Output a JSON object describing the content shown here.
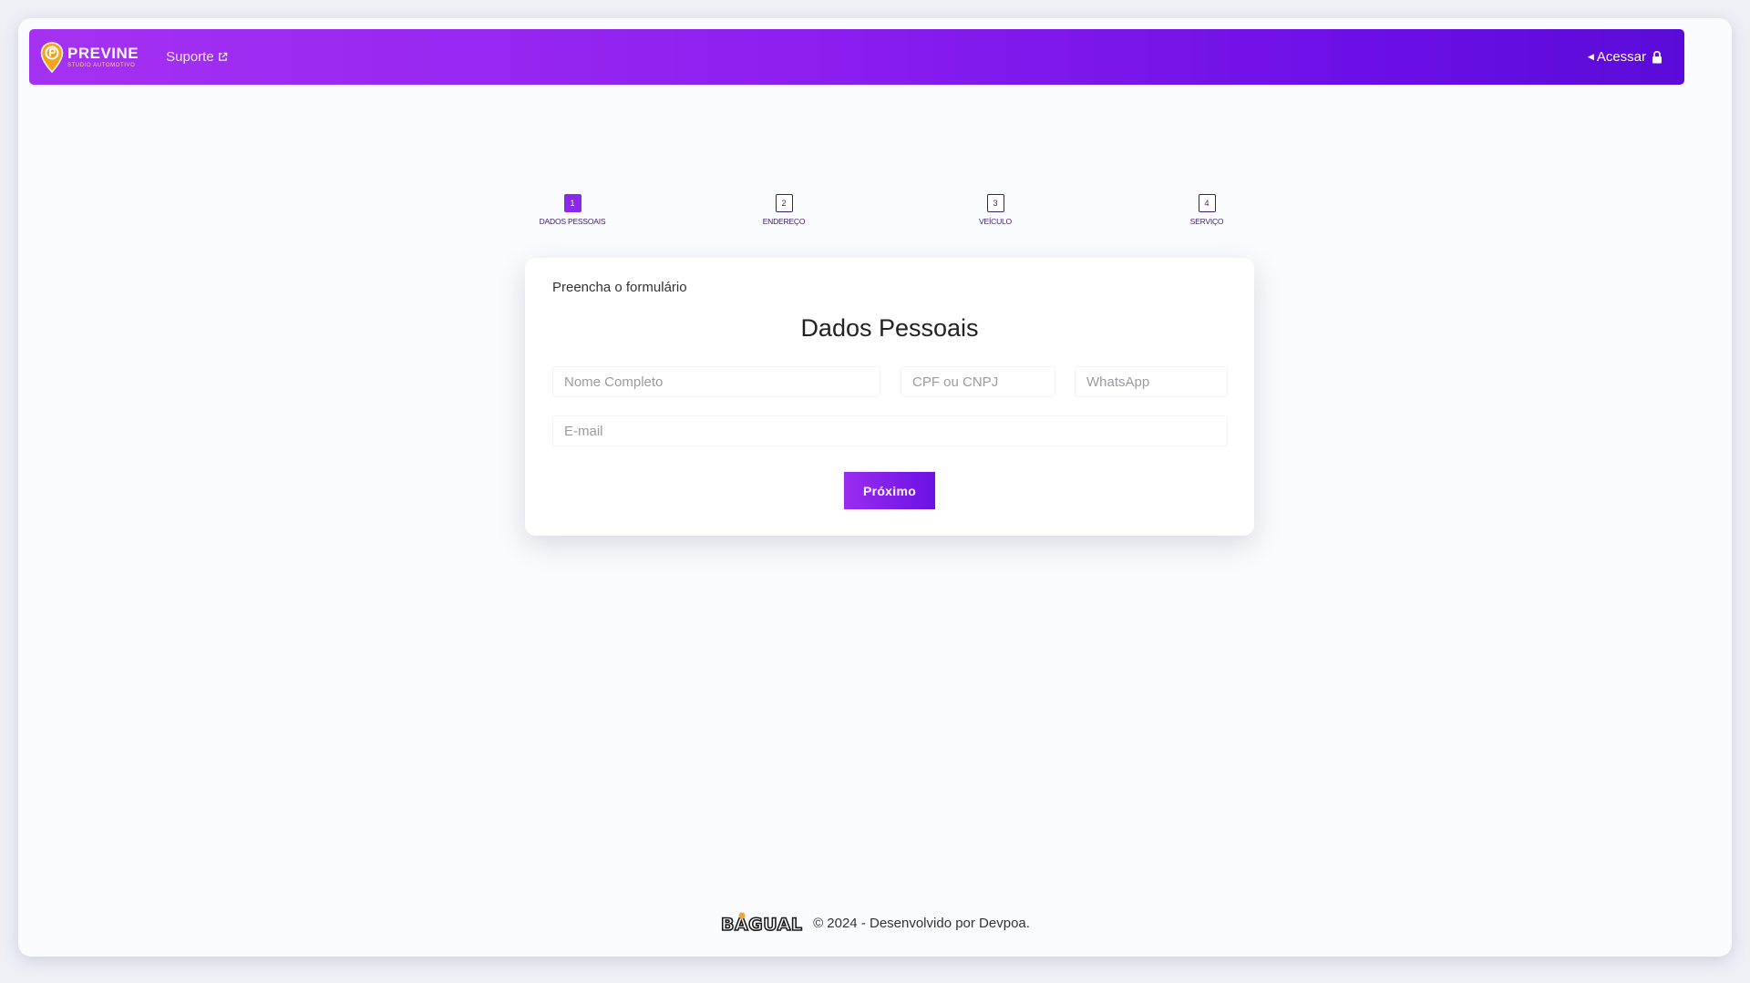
{
  "navbar": {
    "brand_name": "PREVINE",
    "brand_sub": "STUDIO AUTOMOTIVO",
    "support_label": "Suporte",
    "access_label": "Acessar",
    "gradient_start": "#a531f2",
    "gradient_end": "#5a0bd9"
  },
  "steps": [
    {
      "number": "1",
      "label": "DADOS PESSOAIS",
      "active": true
    },
    {
      "number": "2",
      "label": "ENDEREÇO",
      "active": false
    },
    {
      "number": "3",
      "label": "VEÍCULO",
      "active": false
    },
    {
      "number": "4",
      "label": "SERVIÇO",
      "active": false
    }
  ],
  "form": {
    "subtitle": "Preencha o formulário",
    "title": "Dados Pessoais",
    "fields": {
      "name_placeholder": "Nome Completo",
      "cpf_placeholder": "CPF ou CNPJ",
      "whatsapp_placeholder": "WhatsApp",
      "email_placeholder": "E-mail"
    },
    "next_label": "Próximo"
  },
  "footer": {
    "brand": "BAGUAL",
    "text": "© 2024 - Desenvolvido por Devpoa."
  },
  "colors": {
    "accent": "#8a2ae8",
    "step_text": "#3c1d6e"
  }
}
